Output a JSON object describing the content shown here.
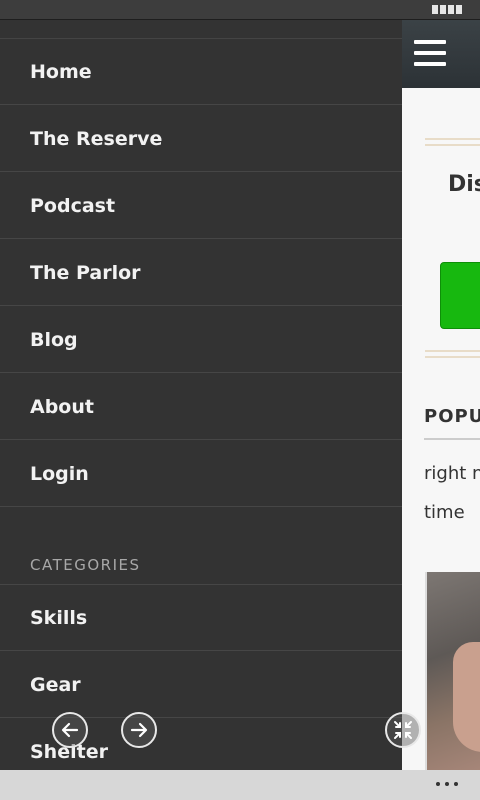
{
  "drawer": {
    "items": [
      {
        "label": "Home"
      },
      {
        "label": "The Reserve"
      },
      {
        "label": "Podcast"
      },
      {
        "label": "The Parlor"
      },
      {
        "label": "Blog"
      },
      {
        "label": "About"
      },
      {
        "label": "Login"
      }
    ],
    "categories_heading": "CATEGORIES",
    "categories": [
      {
        "label": "Skills"
      },
      {
        "label": "Gear"
      },
      {
        "label": "Shelter"
      }
    ]
  },
  "content": {
    "heading_partial": "Dis",
    "popular_heading_partial": "POPUL",
    "text_lines": [
      "right n",
      "time"
    ]
  },
  "colors": {
    "drawer_bg": "#333333",
    "content_bg": "#f7f7f7",
    "accent_green": "#17b80f"
  },
  "icons": {
    "status": "battery-icon",
    "menu": "hamburger-menu-icon",
    "back": "arrow-left-icon",
    "forward": "arrow-right-icon",
    "fullscreen": "collapse-icon",
    "more": "more-dots-icon"
  }
}
